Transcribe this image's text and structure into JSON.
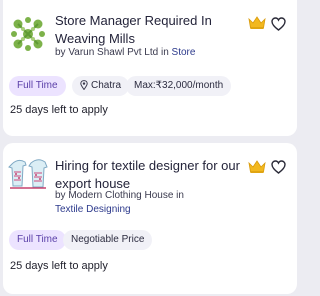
{
  "jobs": [
    {
      "title": "Store Manager Required In Weaving Mills",
      "company_prefix": "by Varun Shawl Pvt Ltd in ",
      "category": "Store",
      "job_type": "Full Time",
      "location": "Chatra",
      "salary": "Max:₹32,000/month",
      "days_left": "25 days left to apply",
      "logo_icon": "green-knot-logo-icon",
      "premium_icon": "crown-icon",
      "save_icon": "heart-outline-icon"
    },
    {
      "title": "Hiring for textile designer for our export house",
      "company_prefix": "by Modern Clothing House in",
      "category": "Textile Designing",
      "job_type": "Full Time",
      "salary": "Negotiable Price",
      "days_left": "25 days left to apply",
      "logo_icon": "t-shirts-logo-icon",
      "premium_icon": "crown-icon",
      "save_icon": "heart-outline-icon"
    }
  ],
  "colors": {
    "background": "#ececf2",
    "card": "#ffffff",
    "tag_type_bg": "#ece3ff",
    "tag_type_text": "#5a3fa8",
    "tag_bg": "#f1f1f7",
    "link": "#2d3a8c",
    "crown": "#f2b81f"
  }
}
